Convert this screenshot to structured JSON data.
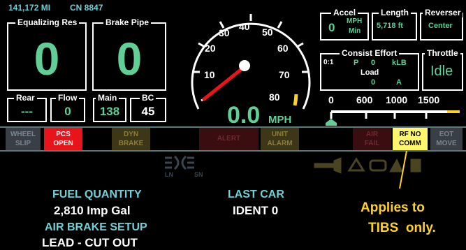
{
  "header": {
    "mileage": "141,172 MI",
    "unit": "CN 8847"
  },
  "equalizing": {
    "label": "Equalizing Res",
    "value": "0"
  },
  "brake_pipe": {
    "label": "Brake Pipe",
    "value": "0"
  },
  "rear": {
    "label": "Rear",
    "value": "---"
  },
  "flow": {
    "label": "Flow",
    "value": "0"
  },
  "main": {
    "label": "Main",
    "value": "138"
  },
  "bc": {
    "label": "BC",
    "value": "45"
  },
  "speedometer": {
    "ticks": [
      "10",
      "20",
      "30",
      "40",
      "50",
      "60",
      "70",
      "80"
    ],
    "speed": "0.0",
    "unit": "MPH"
  },
  "accel": {
    "label": "Accel",
    "value": "0",
    "unit_top": "MPH",
    "unit_bottom": "Min"
  },
  "length": {
    "label": "Length",
    "value": "5,718 ft"
  },
  "reverser": {
    "label": "Reverser",
    "value": "Center"
  },
  "consist": {
    "label": "Consist Effort",
    "ratio": "0:1",
    "p": "P",
    "p_val": "0",
    "unit": "kLB",
    "load_label": "Load",
    "load_val": "0",
    "load_unit": "A"
  },
  "throttle": {
    "label": "Throttle",
    "value": "Idle"
  },
  "scale": {
    "ticks": [
      "0",
      "600",
      "1000",
      "1500"
    ]
  },
  "status_bar": [
    {
      "line1": "WHEEL",
      "line2": "SLIP",
      "bg": "#3a3f47",
      "fg": "#7a8590"
    },
    {
      "line1": "PCS",
      "line2": "OPEN",
      "bg": "#e8141c",
      "fg": "#ffffff"
    },
    {
      "line1": "",
      "line2": "",
      "bg": "#000000",
      "fg": "#000000"
    },
    {
      "line1": "DYN",
      "line2": "BRAKE",
      "bg": "#3d3718",
      "fg": "#8a7c3a"
    },
    {
      "line1": "",
      "line2": "",
      "bg": "#000000",
      "fg": "#000000"
    },
    {
      "line1": "ALERT",
      "line2": "",
      "bg": "#3a0d10",
      "fg": "#6e2a2e"
    },
    {
      "line1": "UNIT",
      "line2": "ALARM",
      "bg": "#3d3718",
      "fg": "#8a7c3a"
    },
    {
      "line1": "",
      "line2": "",
      "bg": "#000000",
      "fg": "#000000"
    },
    {
      "line1": "AIR",
      "line2": "FAIL",
      "bg": "#3a0d10",
      "fg": "#6e2a2e"
    },
    {
      "line1": "RF NO",
      "line2": "COMM",
      "bg": "#fff66e",
      "fg": "#000000"
    },
    {
      "line1": "EOT",
      "line2": "MOVE",
      "bg": "#3a3f47",
      "fg": "#7a8590"
    }
  ],
  "icons": {
    "ln_label": "LN",
    "sn_label": "SN"
  },
  "fuel": {
    "label": "FUEL QUANTITY",
    "value": "2,810 Imp Gal"
  },
  "air_brake": {
    "label": "AIR BRAKE SETUP",
    "value": "LEAD - CUT OUT"
  },
  "last_car": {
    "label": "LAST CAR",
    "value": "IDENT 0"
  },
  "annotation": {
    "line1": "Applies to",
    "line2": "TIBS  only."
  },
  "colors": {
    "accent_green": "#5fcf95",
    "accent_cyan": "#6fd1d8",
    "annotation": "#ffd21f"
  }
}
